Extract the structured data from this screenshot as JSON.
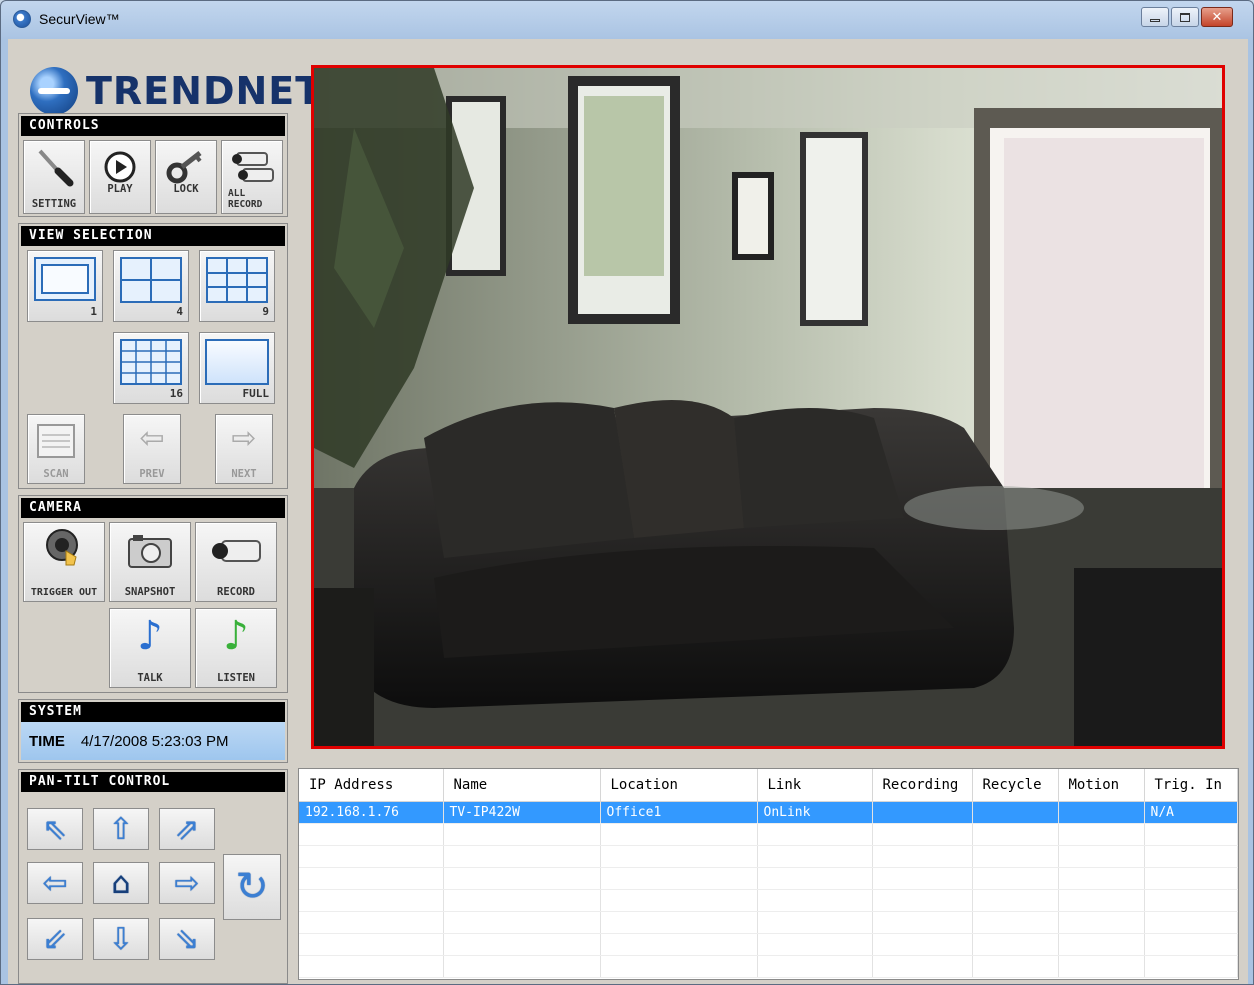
{
  "window": {
    "title": "SecurView™",
    "min_label": "minimize",
    "max_label": "maximize",
    "close_glyph": "✕"
  },
  "logo": {
    "text": "TRENDNET"
  },
  "controls": {
    "header": "CONTROLS",
    "buttons": [
      {
        "label": "SETTING",
        "icon": "screwdriver-icon"
      },
      {
        "label": "PLAY",
        "icon": "play-icon"
      },
      {
        "label": "LOCK",
        "icon": "key-icon"
      },
      {
        "label": "ALL RECORD",
        "icon": "cameras-icon"
      }
    ]
  },
  "view_selection": {
    "header": "VIEW SELECTION",
    "layouts": [
      {
        "num": "1"
      },
      {
        "num": "4"
      },
      {
        "num": "9"
      },
      {
        "num": "16"
      },
      {
        "label": "FULL"
      }
    ],
    "scan": "SCAN",
    "prev": "PREV",
    "next": "NEXT"
  },
  "camera": {
    "header": "CAMERA",
    "trigger": "TRIGGER OUT",
    "snapshot": "SNAPSHOT",
    "record": "RECORD",
    "talk": "TALK",
    "listen": "LISTEN"
  },
  "system": {
    "header": "SYSTEM",
    "time_label": "TIME",
    "time_value": "4/17/2008 5:23:03 PM"
  },
  "ptz": {
    "header": "PAN-TILT CONTROL",
    "arrows": {
      "up_left": "⇖",
      "up": "⇧",
      "up_right": "⇗",
      "left": "⇦",
      "home": "⌂",
      "right": "⇨",
      "down_left": "⇙",
      "down": "⇩",
      "down_right": "⇘",
      "refresh": "↻"
    }
  },
  "colors": {
    "selection": "#3399ff",
    "video_border": "#e00000",
    "header_bg": "#000000"
  },
  "camera_table": {
    "columns": [
      "IP Address",
      "Name",
      "Location",
      "Link",
      "Recording",
      "Recycle",
      "Motion",
      "Trig. In"
    ],
    "rows": [
      [
        "192.168.1.76",
        "TV-IP422W",
        "Office1",
        "OnLink",
        "",
        "",
        "",
        "N/A"
      ]
    ]
  }
}
